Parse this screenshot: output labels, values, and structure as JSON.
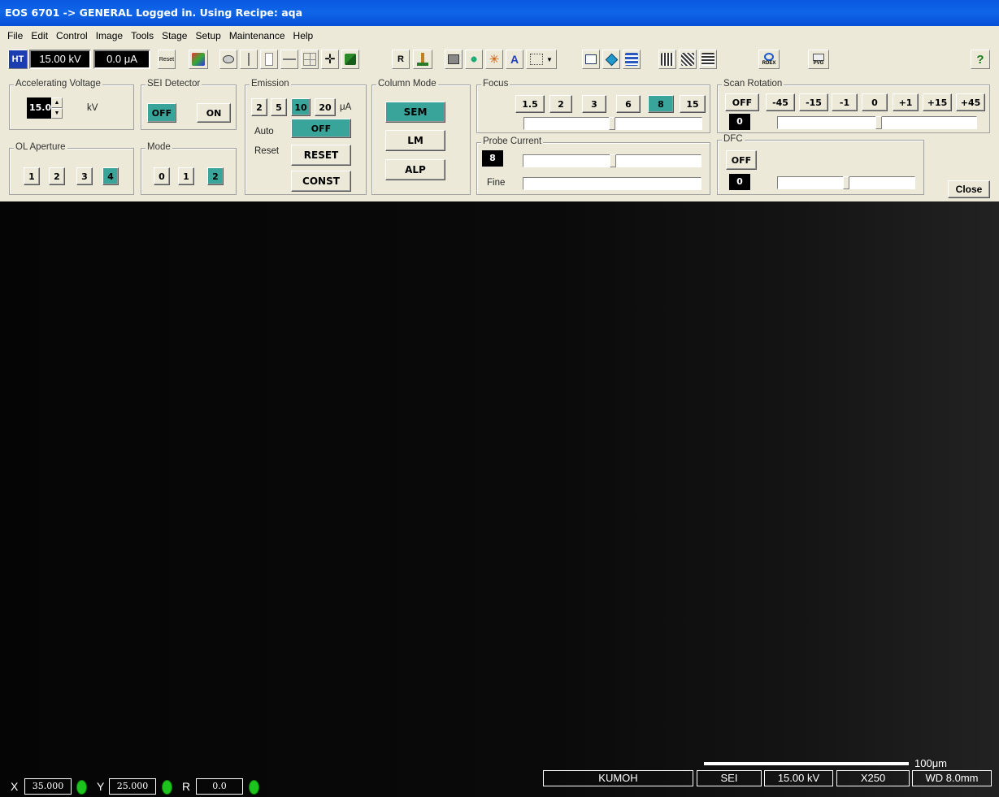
{
  "window": {
    "title": "EOS 6701 -> GENERAL Logged in. Using Recipe: aqa"
  },
  "menu": [
    "File",
    "Edit",
    "Control",
    "Image",
    "Tools",
    "Stage",
    "Setup",
    "Maintenance",
    "Help"
  ],
  "toolbar": {
    "ht_label": "HT",
    "kv_value": "15.00 kV",
    "current_value": "0.0 μA",
    "reset_label": "Reset",
    "rdex_label": "RDEX",
    "pvg_label": "PVG"
  },
  "accel": {
    "label": "Accelerating Voltage",
    "value": "15.0",
    "unit": "kV"
  },
  "sei": {
    "label": "SEI Detector",
    "off": "OFF",
    "on": "ON",
    "active": "OFF"
  },
  "emission": {
    "label": "Emission",
    "options": [
      "2",
      "5",
      "10",
      "20"
    ],
    "selected": "10",
    "unit": "μA",
    "auto_label": "Auto",
    "auto_value": "OFF",
    "reset_label": "Reset",
    "reset_button": "RESET",
    "const_button": "CONST"
  },
  "column": {
    "label": "Column Mode",
    "modes": [
      "SEM",
      "LM",
      "ALP"
    ],
    "selected": "SEM"
  },
  "focus": {
    "label": "Focus",
    "steps": [
      "1.5",
      "2",
      "3",
      "6",
      "8",
      "15"
    ],
    "selected": "8"
  },
  "probe": {
    "label": "Probe Current",
    "value": "8",
    "fine_label": "Fine"
  },
  "scan": {
    "label": "Scan Rotation",
    "buttons": [
      "OFF",
      "-45",
      "-15",
      "-1",
      "0",
      "+1",
      "+15",
      "+45"
    ],
    "value": "0"
  },
  "dfc": {
    "label": "DFC",
    "off": "OFF",
    "value": "0"
  },
  "ol": {
    "label": "OL Aperture",
    "options": [
      "1",
      "2",
      "3",
      "4"
    ],
    "selected": "4"
  },
  "mode": {
    "label": "Mode",
    "options": [
      "0",
      "1",
      "2"
    ],
    "selected": "2"
  },
  "close_label": "Close",
  "status": {
    "x_label": "X",
    "x_value": "35.000",
    "y_label": "Y",
    "y_value": "25.000",
    "r_label": "R",
    "r_value": "0.0",
    "site": "KUMOH",
    "detector": "SEI",
    "kv": "15.00 kV",
    "mag": "X250",
    "wd": "WD 8.0mm",
    "scale": "100μm"
  },
  "colors": {
    "active": "#39a59a",
    "title": "#0a58e0",
    "led": "#1ec41e"
  }
}
